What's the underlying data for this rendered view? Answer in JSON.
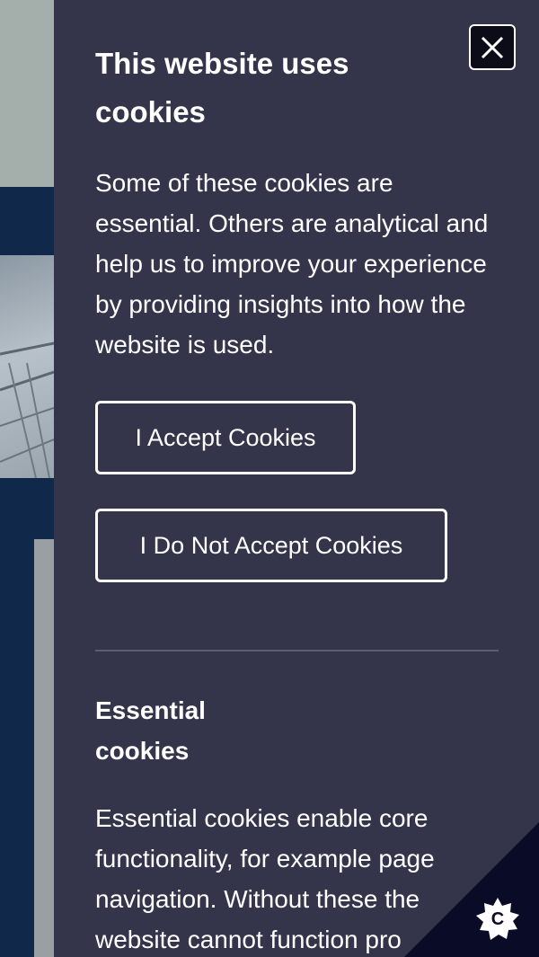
{
  "cookie_panel": {
    "title": "This website uses cookies",
    "intro": "Some of these cookies are essential. Others are analytical and help us to improve your experience by providing insights into how the website is used.",
    "accept_label": "I Accept Cookies",
    "reject_label": "I Do Not Accept Cookies",
    "essential_title": "Essential cookies",
    "essential_text": "Essential cookies enable core functionality, for example page navigation. Without these the website cannot function pro",
    "close_icon": "close-icon"
  },
  "corner_widget": {
    "letter": "C",
    "icon": "cookie-settings-icon"
  },
  "colors": {
    "panel_background": "#34344a",
    "page_navy": "#10294b",
    "corner_background": "#0a0b26",
    "text": "#ffffff"
  }
}
